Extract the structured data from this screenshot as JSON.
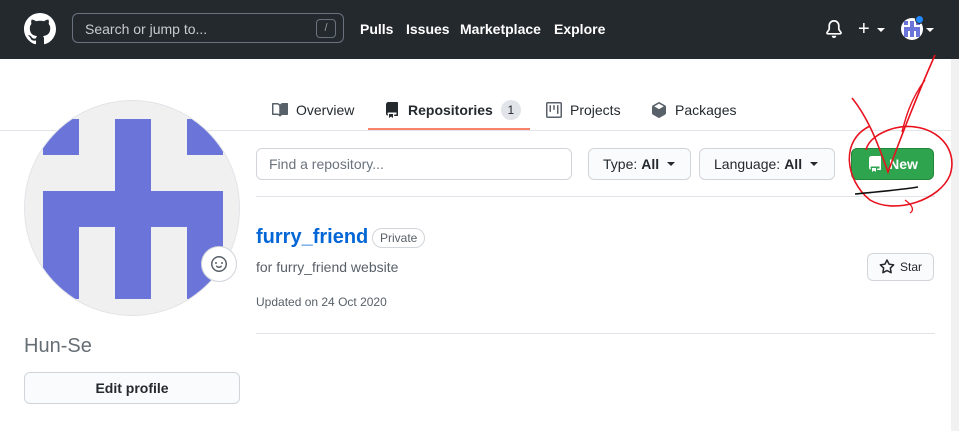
{
  "header": {
    "search_placeholder": "Search or jump to...",
    "search_shortcut": "/",
    "nav": [
      "Pulls",
      "Issues",
      "Marketplace",
      "Explore"
    ],
    "plus_label": "+"
  },
  "tabs": [
    {
      "label": "Overview",
      "icon": "book-icon"
    },
    {
      "label": "Repositories",
      "icon": "repo-icon",
      "count": "1",
      "active": true
    },
    {
      "label": "Projects",
      "icon": "project-icon"
    },
    {
      "label": "Packages",
      "icon": "package-icon"
    }
  ],
  "profile": {
    "username": "Hun-Se",
    "edit_label": "Edit profile"
  },
  "filters": {
    "find_placeholder": "Find a repository...",
    "type_label": "Type:",
    "type_value": "All",
    "language_label": "Language:",
    "language_value": "All",
    "new_label": "New"
  },
  "repo": {
    "name": "furry_friend",
    "visibility": "Private",
    "description": "for furry_friend website",
    "updated": "Updated on 24 Oct 2020",
    "star_label": "Star"
  },
  "colors": {
    "header_bg": "#24292e",
    "accent_green": "#2ea44f",
    "link_blue": "#0366d6",
    "tab_underline": "#f9826c",
    "identicon": "#6b74d8",
    "annotation_red": "#e8121e"
  }
}
